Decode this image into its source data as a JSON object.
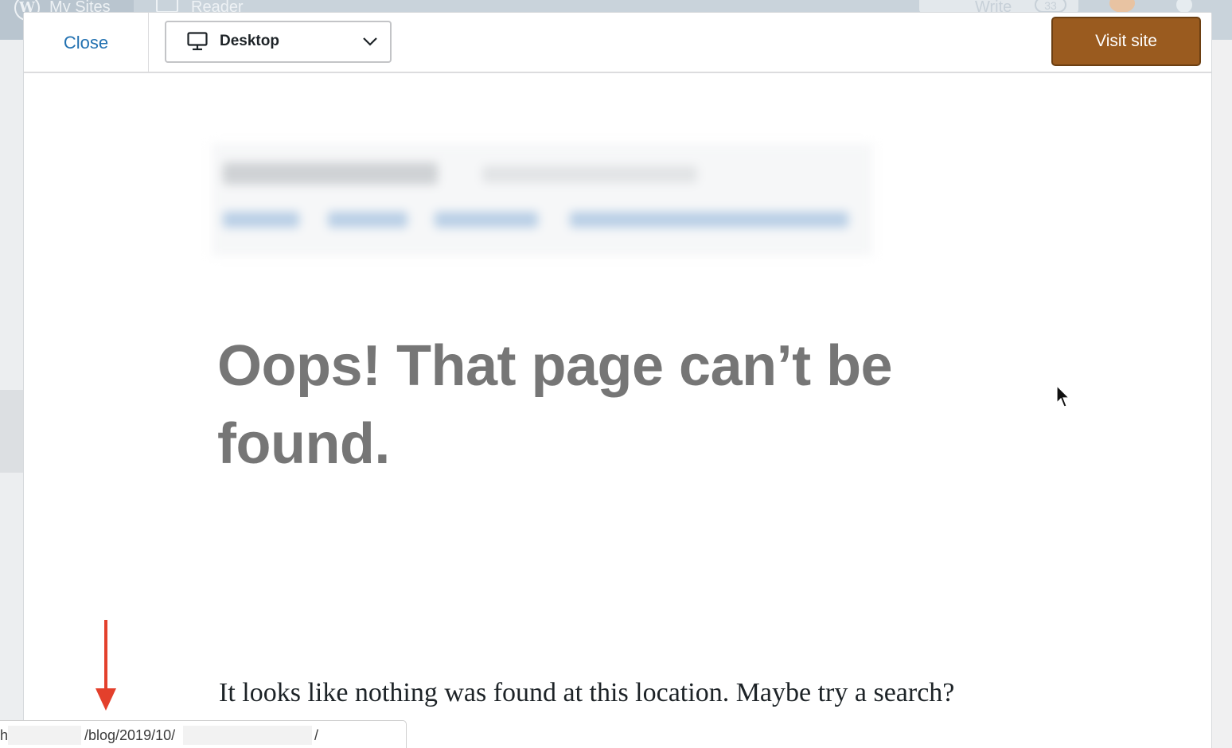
{
  "adminbar": {
    "my_sites_label": "My Sites",
    "reader_label": "Reader",
    "write_label": "Write",
    "write_count": "33"
  },
  "toolbar": {
    "close_label": "Close",
    "device_label": "Desktop",
    "visit_label": "Visit site"
  },
  "preview": {
    "heading": "Oops! That page can’t be found.",
    "body_text": "It looks like nothing was found at this location. Maybe try a search?"
  },
  "status_bar": {
    "url_prefix": "h",
    "url_path": "/blog/2019/10/",
    "url_suffix": "/"
  },
  "colors": {
    "visit_button": "#9a5b1f",
    "close_link": "#2271b1",
    "annotation_arrow": "#e3402c"
  }
}
